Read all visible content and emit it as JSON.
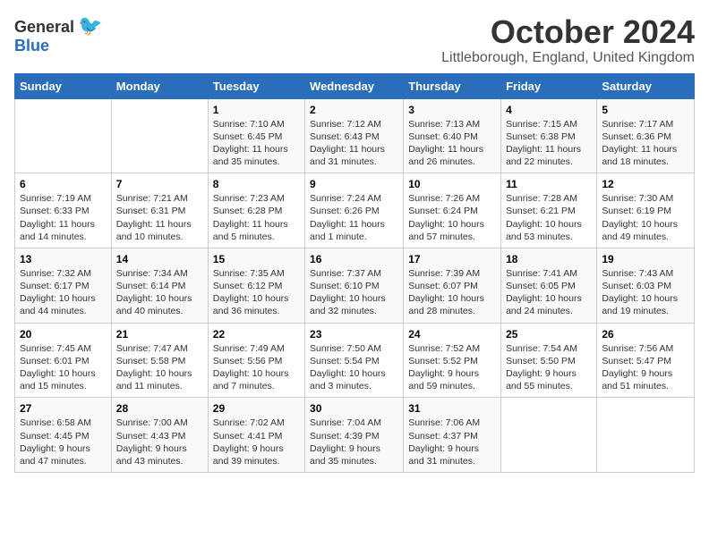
{
  "header": {
    "logo_general": "General",
    "logo_blue": "Blue",
    "month_title": "October 2024",
    "location": "Littleborough, England, United Kingdom"
  },
  "days_of_week": [
    "Sunday",
    "Monday",
    "Tuesday",
    "Wednesday",
    "Thursday",
    "Friday",
    "Saturday"
  ],
  "weeks": [
    [
      {
        "num": "",
        "sunrise": "",
        "sunset": "",
        "daylight": ""
      },
      {
        "num": "",
        "sunrise": "",
        "sunset": "",
        "daylight": ""
      },
      {
        "num": "1",
        "sunrise": "Sunrise: 7:10 AM",
        "sunset": "Sunset: 6:45 PM",
        "daylight": "Daylight: 11 hours and 35 minutes."
      },
      {
        "num": "2",
        "sunrise": "Sunrise: 7:12 AM",
        "sunset": "Sunset: 6:43 PM",
        "daylight": "Daylight: 11 hours and 31 minutes."
      },
      {
        "num": "3",
        "sunrise": "Sunrise: 7:13 AM",
        "sunset": "Sunset: 6:40 PM",
        "daylight": "Daylight: 11 hours and 26 minutes."
      },
      {
        "num": "4",
        "sunrise": "Sunrise: 7:15 AM",
        "sunset": "Sunset: 6:38 PM",
        "daylight": "Daylight: 11 hours and 22 minutes."
      },
      {
        "num": "5",
        "sunrise": "Sunrise: 7:17 AM",
        "sunset": "Sunset: 6:36 PM",
        "daylight": "Daylight: 11 hours and 18 minutes."
      }
    ],
    [
      {
        "num": "6",
        "sunrise": "Sunrise: 7:19 AM",
        "sunset": "Sunset: 6:33 PM",
        "daylight": "Daylight: 11 hours and 14 minutes."
      },
      {
        "num": "7",
        "sunrise": "Sunrise: 7:21 AM",
        "sunset": "Sunset: 6:31 PM",
        "daylight": "Daylight: 11 hours and 10 minutes."
      },
      {
        "num": "8",
        "sunrise": "Sunrise: 7:23 AM",
        "sunset": "Sunset: 6:28 PM",
        "daylight": "Daylight: 11 hours and 5 minutes."
      },
      {
        "num": "9",
        "sunrise": "Sunrise: 7:24 AM",
        "sunset": "Sunset: 6:26 PM",
        "daylight": "Daylight: 11 hours and 1 minute."
      },
      {
        "num": "10",
        "sunrise": "Sunrise: 7:26 AM",
        "sunset": "Sunset: 6:24 PM",
        "daylight": "Daylight: 10 hours and 57 minutes."
      },
      {
        "num": "11",
        "sunrise": "Sunrise: 7:28 AM",
        "sunset": "Sunset: 6:21 PM",
        "daylight": "Daylight: 10 hours and 53 minutes."
      },
      {
        "num": "12",
        "sunrise": "Sunrise: 7:30 AM",
        "sunset": "Sunset: 6:19 PM",
        "daylight": "Daylight: 10 hours and 49 minutes."
      }
    ],
    [
      {
        "num": "13",
        "sunrise": "Sunrise: 7:32 AM",
        "sunset": "Sunset: 6:17 PM",
        "daylight": "Daylight: 10 hours and 44 minutes."
      },
      {
        "num": "14",
        "sunrise": "Sunrise: 7:34 AM",
        "sunset": "Sunset: 6:14 PM",
        "daylight": "Daylight: 10 hours and 40 minutes."
      },
      {
        "num": "15",
        "sunrise": "Sunrise: 7:35 AM",
        "sunset": "Sunset: 6:12 PM",
        "daylight": "Daylight: 10 hours and 36 minutes."
      },
      {
        "num": "16",
        "sunrise": "Sunrise: 7:37 AM",
        "sunset": "Sunset: 6:10 PM",
        "daylight": "Daylight: 10 hours and 32 minutes."
      },
      {
        "num": "17",
        "sunrise": "Sunrise: 7:39 AM",
        "sunset": "Sunset: 6:07 PM",
        "daylight": "Daylight: 10 hours and 28 minutes."
      },
      {
        "num": "18",
        "sunrise": "Sunrise: 7:41 AM",
        "sunset": "Sunset: 6:05 PM",
        "daylight": "Daylight: 10 hours and 24 minutes."
      },
      {
        "num": "19",
        "sunrise": "Sunrise: 7:43 AM",
        "sunset": "Sunset: 6:03 PM",
        "daylight": "Daylight: 10 hours and 19 minutes."
      }
    ],
    [
      {
        "num": "20",
        "sunrise": "Sunrise: 7:45 AM",
        "sunset": "Sunset: 6:01 PM",
        "daylight": "Daylight: 10 hours and 15 minutes."
      },
      {
        "num": "21",
        "sunrise": "Sunrise: 7:47 AM",
        "sunset": "Sunset: 5:58 PM",
        "daylight": "Daylight: 10 hours and 11 minutes."
      },
      {
        "num": "22",
        "sunrise": "Sunrise: 7:49 AM",
        "sunset": "Sunset: 5:56 PM",
        "daylight": "Daylight: 10 hours and 7 minutes."
      },
      {
        "num": "23",
        "sunrise": "Sunrise: 7:50 AM",
        "sunset": "Sunset: 5:54 PM",
        "daylight": "Daylight: 10 hours and 3 minutes."
      },
      {
        "num": "24",
        "sunrise": "Sunrise: 7:52 AM",
        "sunset": "Sunset: 5:52 PM",
        "daylight": "Daylight: 9 hours and 59 minutes."
      },
      {
        "num": "25",
        "sunrise": "Sunrise: 7:54 AM",
        "sunset": "Sunset: 5:50 PM",
        "daylight": "Daylight: 9 hours and 55 minutes."
      },
      {
        "num": "26",
        "sunrise": "Sunrise: 7:56 AM",
        "sunset": "Sunset: 5:47 PM",
        "daylight": "Daylight: 9 hours and 51 minutes."
      }
    ],
    [
      {
        "num": "27",
        "sunrise": "Sunrise: 6:58 AM",
        "sunset": "Sunset: 4:45 PM",
        "daylight": "Daylight: 9 hours and 47 minutes."
      },
      {
        "num": "28",
        "sunrise": "Sunrise: 7:00 AM",
        "sunset": "Sunset: 4:43 PM",
        "daylight": "Daylight: 9 hours and 43 minutes."
      },
      {
        "num": "29",
        "sunrise": "Sunrise: 7:02 AM",
        "sunset": "Sunset: 4:41 PM",
        "daylight": "Daylight: 9 hours and 39 minutes."
      },
      {
        "num": "30",
        "sunrise": "Sunrise: 7:04 AM",
        "sunset": "Sunset: 4:39 PM",
        "daylight": "Daylight: 9 hours and 35 minutes."
      },
      {
        "num": "31",
        "sunrise": "Sunrise: 7:06 AM",
        "sunset": "Sunset: 4:37 PM",
        "daylight": "Daylight: 9 hours and 31 minutes."
      },
      {
        "num": "",
        "sunrise": "",
        "sunset": "",
        "daylight": ""
      },
      {
        "num": "",
        "sunrise": "",
        "sunset": "",
        "daylight": ""
      }
    ]
  ]
}
